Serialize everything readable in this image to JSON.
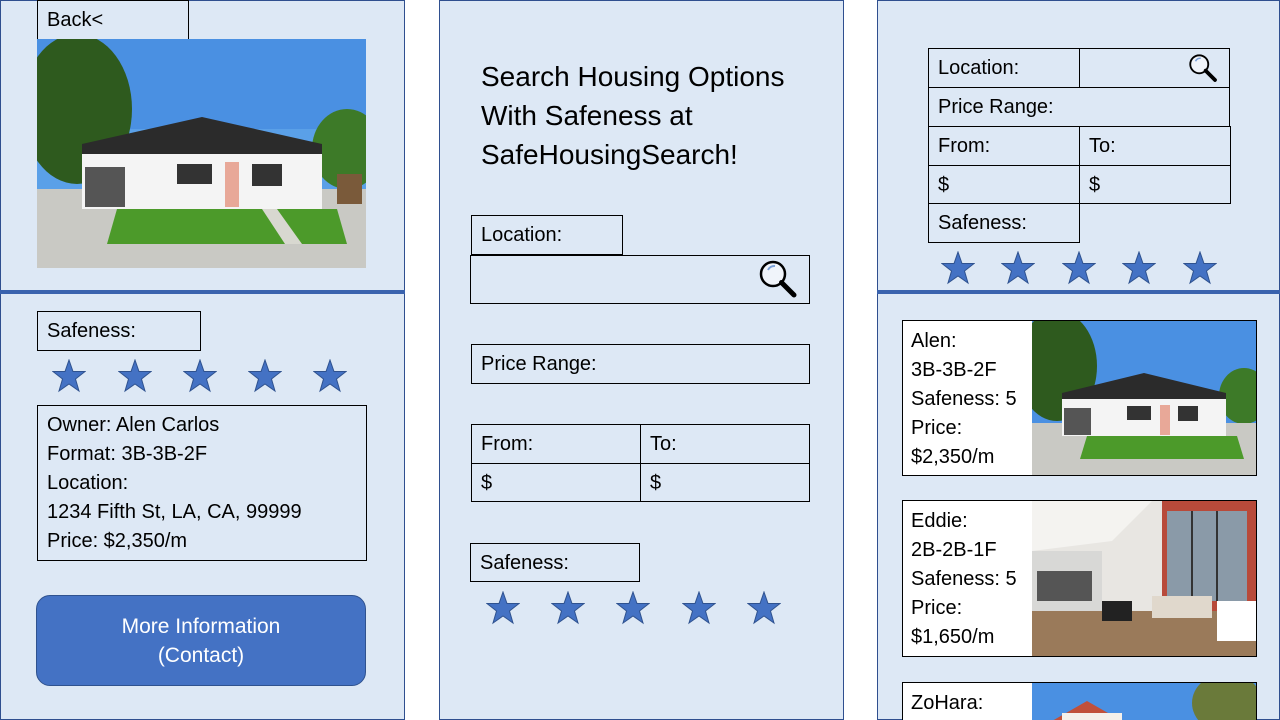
{
  "detail": {
    "back_label": "Back<",
    "safeness_label": "Safeness:",
    "stars_count": 5,
    "info": {
      "owner": "Owner: Alen Carlos",
      "format": "Format: 3B-3B-2F",
      "location_label": "Location:",
      "address": "1234 Fifth St, LA, CA, 99999",
      "price": "Price: $2,350/m"
    },
    "more_info_line1": "More Information",
    "more_info_line2": "(Contact)"
  },
  "search": {
    "title_line1": "Search Housing Options",
    "title_line2": "With Safeness at",
    "title_line3": "SafeHousingSearch!",
    "location_label": "Location:",
    "location_value": "",
    "price_range_label": "Price Range:",
    "from_label": "From:",
    "to_label": "To:",
    "from_value": "$",
    "to_value": "$",
    "safeness_label": "Safeness:",
    "search_icon": "search-icon"
  },
  "results": {
    "filter": {
      "location_label": "Location:",
      "price_range_label": "Price Range:",
      "from_label": "From:",
      "to_label": "To:",
      "from_value": "$",
      "to_value": "$",
      "safeness_label": "Safeness:"
    },
    "listings": [
      {
        "name": "Alen:",
        "format": "3B-3B-2F",
        "safeness": "Safeness: 5",
        "price_label": "Price:",
        "price": "$2,350/m"
      },
      {
        "name": "Eddie:",
        "format": "2B-2B-1F",
        "safeness": "Safeness: 5",
        "price_label": "Price:",
        "price": "$1,650/m"
      },
      {
        "name": "ZoHara:"
      }
    ]
  },
  "colors": {
    "panel_bg": "#dde8f5",
    "accent": "#4472c4",
    "divider": "#3a63ae"
  }
}
